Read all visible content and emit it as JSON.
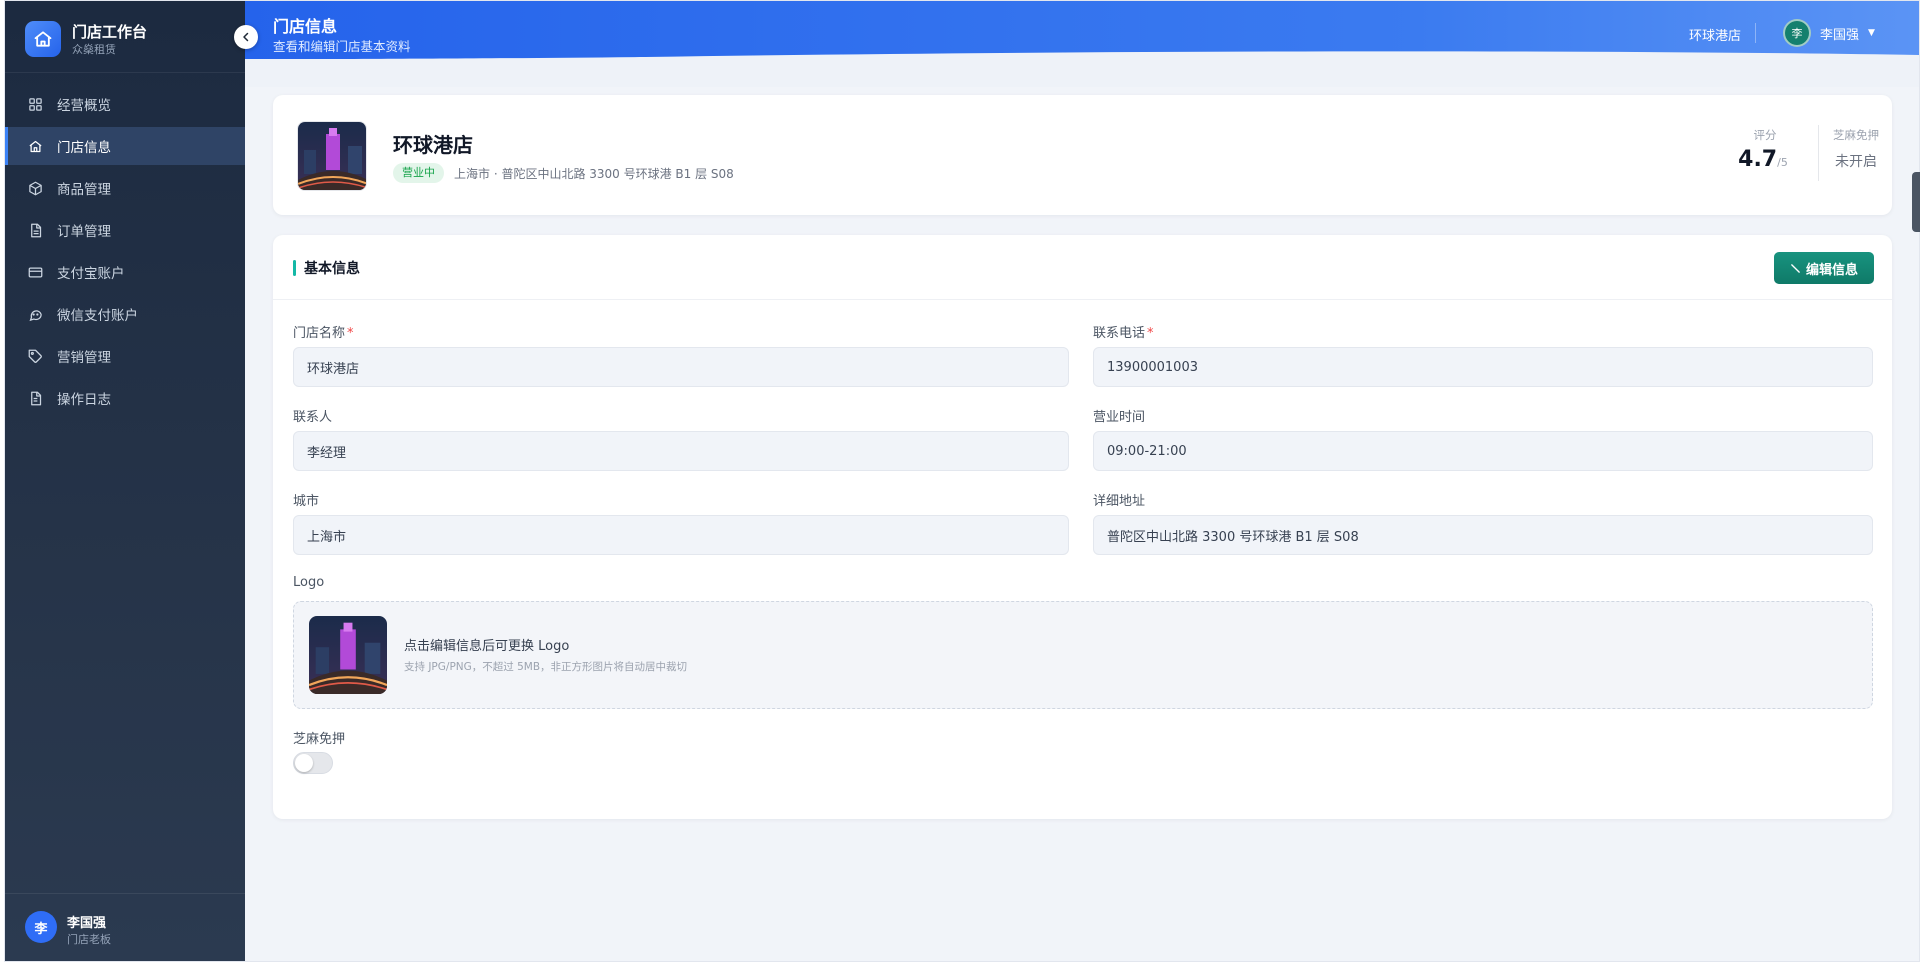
{
  "sidebar": {
    "brand_title": "门店工作台",
    "brand_subtitle": "众燊租赁",
    "items": [
      {
        "label": "经营概览",
        "icon": "grid-icon"
      },
      {
        "label": "门店信息",
        "icon": "home-icon",
        "active": true
      },
      {
        "label": "商品管理",
        "icon": "box-icon"
      },
      {
        "label": "订单管理",
        "icon": "file-text-icon"
      },
      {
        "label": "支付宝账户",
        "icon": "credit-card-icon"
      },
      {
        "label": "微信支付账户",
        "icon": "chat-icon"
      },
      {
        "label": "营销管理",
        "icon": "tag-icon"
      },
      {
        "label": "操作日志",
        "icon": "document-icon"
      }
    ],
    "user": {
      "avatar_text": "李",
      "name": "李国强",
      "role": "门店老板"
    }
  },
  "header": {
    "title": "门店信息",
    "subtitle": "查看和编辑门店基本资料",
    "store_name": "环球港店",
    "user_avatar_text": "李",
    "user_name": "李国强",
    "caret": "▼"
  },
  "store_card": {
    "name": "环球港店",
    "status": "营业中",
    "address": "上海市 · 普陀区中山北路 3300 号环球港 B1 层 S08",
    "rating_label": "评分",
    "rating_value": "4.7",
    "rating_max": "/5",
    "zhima_label": "芝麻免押",
    "zhima_value": "未开启"
  },
  "basic_info": {
    "section_title": "基本信息",
    "edit_button": "编辑信息",
    "fields": {
      "store_name": {
        "label": "门店名称",
        "value": "环球港店",
        "required": "*"
      },
      "phone": {
        "label": "联系电话",
        "value": "13900001003",
        "required": "*"
      },
      "contact": {
        "label": "联系人",
        "value": "李经理"
      },
      "hours": {
        "label": "营业时间",
        "value": "09:00-21:00"
      },
      "city": {
        "label": "城市",
        "value": "上海市"
      },
      "address": {
        "label": "详细地址",
        "value": "普陀区中山北路 3300 号环球港 B1 层 S08"
      }
    },
    "logo": {
      "label": "Logo",
      "hint": "点击编辑信息后可更换 Logo",
      "sub": "支持 JPG/PNG，不超过 5MB，非正方形图片将自动居中裁切"
    },
    "zhima": {
      "label": "芝麻免押",
      "enabled": false
    }
  },
  "colors": {
    "accent": "#2563eb",
    "primary_button": "#0f7a68",
    "status_green": "#16a34a",
    "sidebar_bg": "#1c2a40"
  }
}
